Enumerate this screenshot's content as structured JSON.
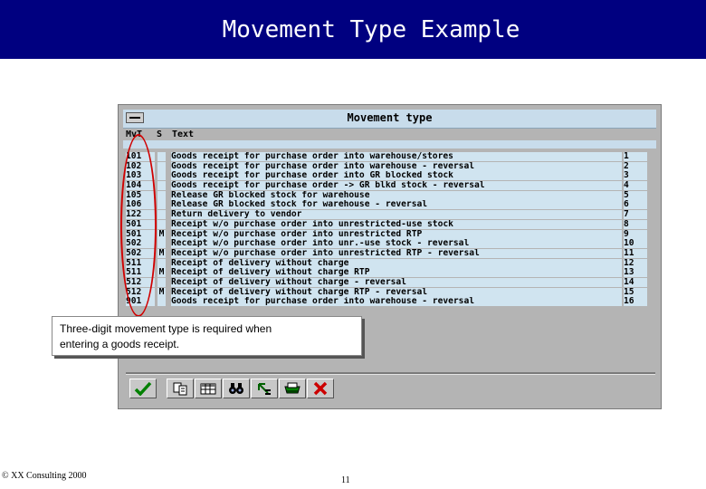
{
  "slide": {
    "title": "Movement Type Example"
  },
  "window": {
    "title": "Movement type",
    "columns": {
      "mvt": "MvT",
      "s": "S",
      "text": "Text"
    },
    "rows": [
      {
        "mvt": "101",
        "s": "",
        "text": "Goods receipt for purchase order into warehouse/stores",
        "num": "1"
      },
      {
        "mvt": "102",
        "s": "",
        "text": "Goods receipt for purchase order into warehouse - reversal",
        "num": "2"
      },
      {
        "mvt": "103",
        "s": "",
        "text": "Goods receipt for purchase order into GR blocked stock",
        "num": "3"
      },
      {
        "mvt": "104",
        "s": "",
        "text": "Goods receipt for purchase order -> GR blkd stock - reversal",
        "num": "4"
      },
      {
        "mvt": "105",
        "s": "",
        "text": "Release GR blocked stock for warehouse",
        "num": "5"
      },
      {
        "mvt": "106",
        "s": "",
        "text": "Release GR blocked stock for warehouse - reversal",
        "num": "6"
      },
      {
        "mvt": "122",
        "s": "",
        "text": "Return delivery to vendor",
        "num": "7"
      },
      {
        "mvt": "501",
        "s": "",
        "text": "Receipt w/o purchase order into unrestricted-use stock",
        "num": "8"
      },
      {
        "mvt": "501",
        "s": "M",
        "text": "Receipt w/o purchase order into unrestricted RTP",
        "num": "9"
      },
      {
        "mvt": "502",
        "s": "",
        "text": "Receipt w/o purchase order into unr.-use stock - reversal",
        "num": "10"
      },
      {
        "mvt": "502",
        "s": "M",
        "text": "Receipt w/o purchase order into unrestricted RTP - reversal",
        "num": "11"
      },
      {
        "mvt": "511",
        "s": "",
        "text": "Receipt of delivery without charge",
        "num": "12"
      },
      {
        "mvt": "511",
        "s": "M",
        "text": "Receipt of delivery without charge RTP",
        "num": "13"
      },
      {
        "mvt": "512",
        "s": "",
        "text": "Receipt of delivery without charge - reversal",
        "num": "14"
      },
      {
        "mvt": "512",
        "s": "M",
        "text": "Receipt of delivery without charge RTP - reversal",
        "num": "15"
      },
      {
        "mvt": "901",
        "s": "",
        "text": "Goods receipt for purchase order into warehouse - reversal",
        "num": "16"
      }
    ]
  },
  "callout": {
    "line1": "Three-digit movement type is required when",
    "line2": "entering a goods receipt."
  },
  "toolbar": {
    "buttons": [
      {
        "icon": "checkmark-icon"
      },
      {
        "icon": "document-copy-icon"
      },
      {
        "icon": "table-grid-icon"
      },
      {
        "icon": "binoculars-icon"
      },
      {
        "icon": "arrow-tree-icon"
      },
      {
        "icon": "print-icon"
      },
      {
        "icon": "cancel-x-icon"
      }
    ]
  },
  "colors": {
    "header_bg": "#000080",
    "row_bg": "#d0e4f0",
    "highlight": "#d00000",
    "window_bg": "#b4b4b4"
  },
  "footer": {
    "copyright": "© XX Consulting 2000",
    "page": "11"
  }
}
